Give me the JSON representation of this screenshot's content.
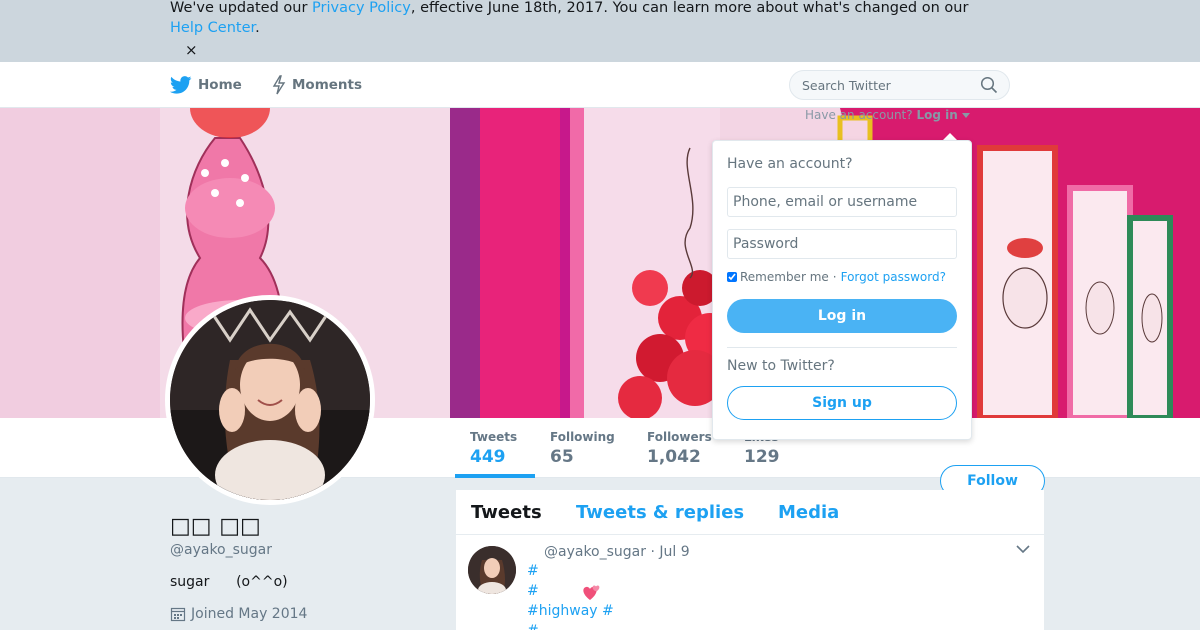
{
  "banner": {
    "text_before": "We've updated our ",
    "privacy_link": "Privacy Policy",
    "text_middle": ", effective June 18th, 2017. You can learn more about what's changed on our ",
    "help_link": "Help Center",
    "text_after": ".",
    "close": "×"
  },
  "nav": {
    "home": "Home",
    "moments": "Moments",
    "search_placeholder": "Search Twitter",
    "have_account": "Have an account?",
    "login": "Log in"
  },
  "login_dropdown": {
    "title": "Have an account?",
    "username_placeholder": "Phone, email or username",
    "password_placeholder": "Password",
    "remember": "Remember me",
    "separator": "·",
    "forgot": "Forgot password?",
    "login_button": "Log in",
    "new_to": "New to Twitter?",
    "signup_button": "Sign up"
  },
  "stats": [
    {
      "label": "Tweets",
      "value": "449"
    },
    {
      "label": "Following",
      "value": "65"
    },
    {
      "label": "Followers",
      "value": "1,042"
    },
    {
      "label": "Likes",
      "value": "129"
    }
  ],
  "profile": {
    "fullname": "□□ □□",
    "handle": "@ayako_sugar",
    "bio": "sugar      (o^^o)",
    "joined": "Joined May 2014",
    "follow_button": "Follow"
  },
  "timeline": {
    "tabs": [
      "Tweets",
      "Tweets & replies",
      "Media"
    ],
    "tweet": {
      "meta": "@ayako_sugar · Jul 9",
      "lines": [
        "#",
        "#",
        "#highway #",
        "#"
      ]
    }
  },
  "colors": {
    "accent": "#1da1f2",
    "banner": "#ccd6dd",
    "background": "#e6ecf0"
  }
}
